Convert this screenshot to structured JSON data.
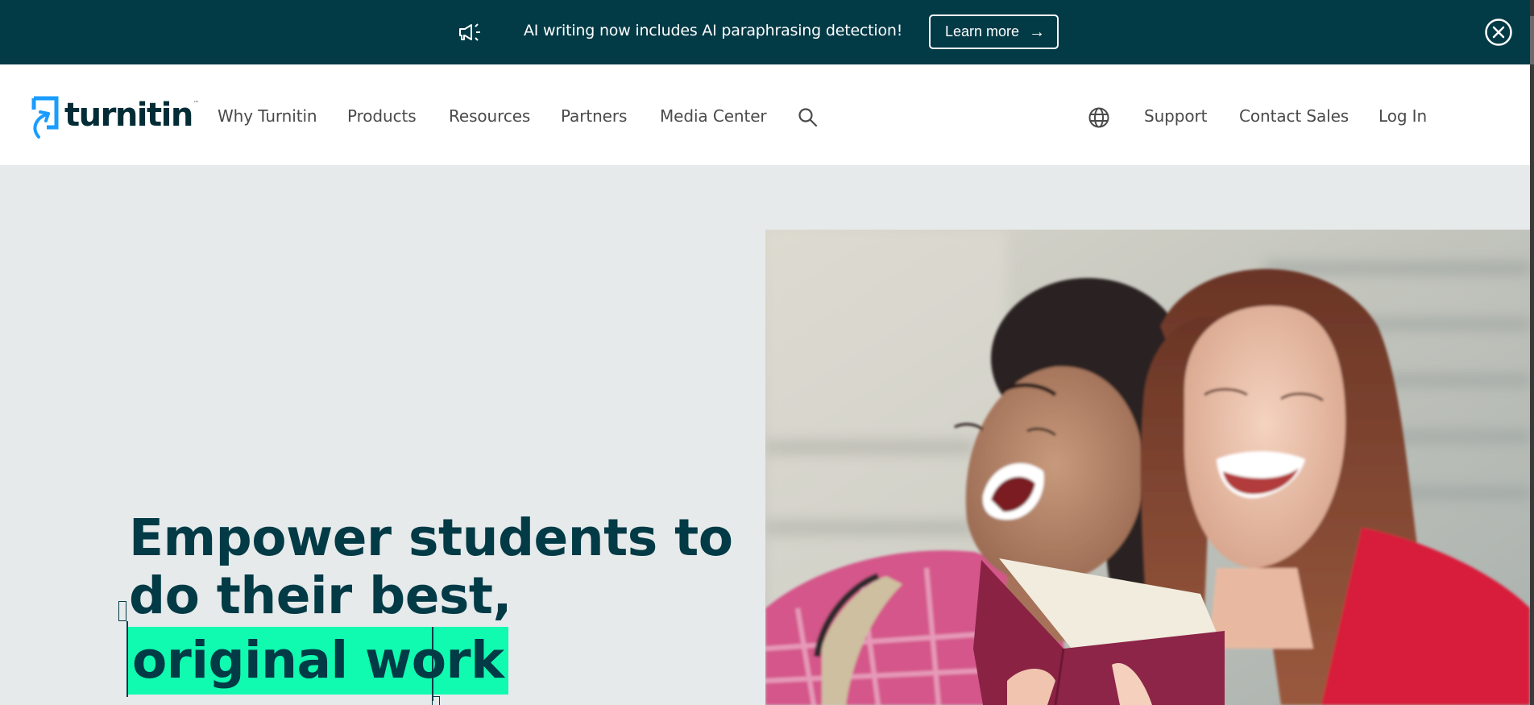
{
  "banner": {
    "icon": "megaphone-icon",
    "message": "AI writing now includes AI paraphrasing detection!",
    "cta_label": "Learn more",
    "cta_icon": "arrow-right-icon",
    "close_icon": "close-circle-icon",
    "background_color": "#023a46"
  },
  "nav": {
    "logo_text": "turnitin",
    "logo_tm": "™",
    "items": [
      {
        "label": "Why Turnitin"
      },
      {
        "label": "Products"
      },
      {
        "label": "Resources"
      },
      {
        "label": "Partners"
      },
      {
        "label": "Media Center"
      }
    ],
    "search_icon": "search-icon",
    "globe_icon": "globe-icon",
    "right_items": [
      {
        "label": "Support"
      },
      {
        "label": "Contact Sales"
      },
      {
        "label": "Log In"
      }
    ]
  },
  "hero": {
    "headline_line1": "Empower students to",
    "headline_line2": "do their best,",
    "headline_highlight": "original work",
    "highlight_color": "#10fbb0",
    "text_color": "#023a46",
    "image_alt": "Two students laughing while reading a book"
  }
}
